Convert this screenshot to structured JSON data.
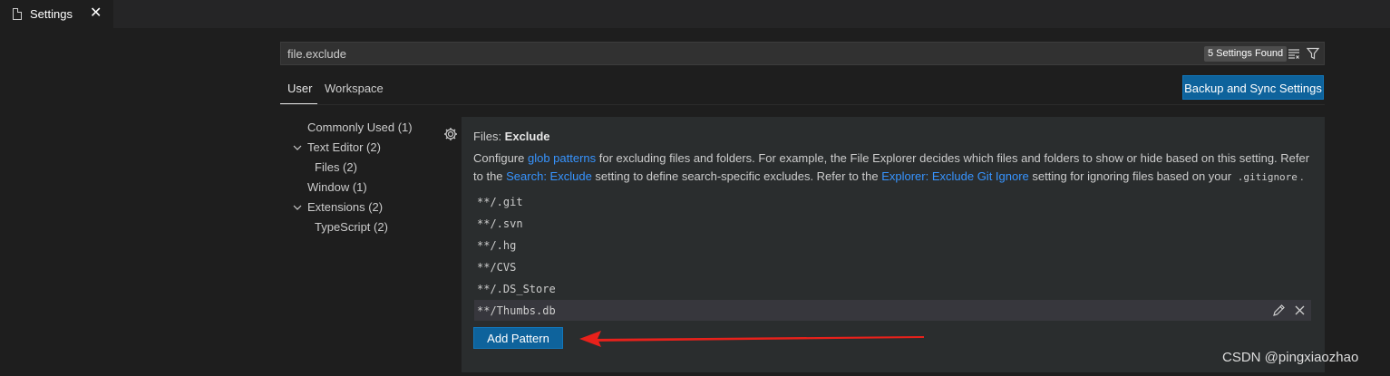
{
  "tab": {
    "title": "Settings",
    "close": "✕"
  },
  "search": {
    "value": "file.exclude",
    "count": "5 Settings Found"
  },
  "scopes": {
    "user": "User",
    "workspace": "Workspace"
  },
  "sync_button": "Backup and Sync Settings",
  "toc": [
    {
      "label": "Commonly Used (1)"
    },
    {
      "label": "Text Editor (2)"
    },
    {
      "label": "Files (2)"
    },
    {
      "label": "Window (1)"
    },
    {
      "label": "Extensions (2)"
    },
    {
      "label": "TypeScript (2)"
    }
  ],
  "setting": {
    "category": "Files: ",
    "name": "Exclude",
    "desc_1": "Configure ",
    "link_glob": "glob patterns",
    "desc_2": " for excluding files and folders. For example, the File Explorer decides which files and folders to show or hide based on this setting. Refer to the ",
    "link_search": "Search: Exclude",
    "desc_3": " setting to define search-specific excludes. Refer to the ",
    "link_git": "Explorer: Exclude Git Ignore",
    "desc_4": " setting for ignoring files based on your ",
    "code": ".gitignore",
    "desc_5": ".",
    "patterns": [
      "**/.git",
      "**/.svn",
      "**/.hg",
      "**/CVS",
      "**/.DS_Store",
      "**/Thumbs.db"
    ],
    "add_button": "Add Pattern"
  },
  "watermark": "CSDN @pingxiaozhao",
  "colors": {
    "accent": "#0e639c",
    "link": "#3794ff",
    "annotation": "#e8211b"
  }
}
